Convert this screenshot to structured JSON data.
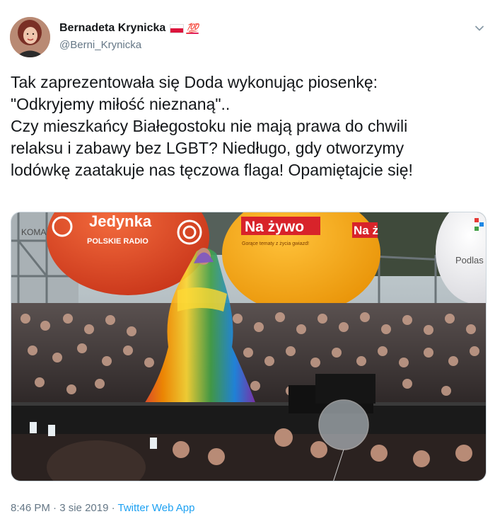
{
  "author": {
    "display_name": "Bernadeta Krynicka",
    "handle": "@Berni_Krynicka",
    "badge": "💯"
  },
  "tweet": {
    "lines": [
      "Tak zaprezentowała się Doda wykonując piosenkę:",
      "\"Odkryjemy miłość nieznaną\"..",
      "Czy mieszkańcy Białegostoku nie mają prawa do chwili",
      "relaksu i zabawy bez LGBT? Niedługo, gdy otworzymy",
      "lodówkę zaatakuje nas tęczowa flaga! Opamiętajcie się!"
    ]
  },
  "photo": {
    "balloon_left_title": "Jedynka",
    "balloon_left_subtitle": "POLSKIE RADIO",
    "balloon_center_title": "Na żywo",
    "balloon_center_subtitle": "Gorące tematy z życia gwiazd!",
    "balloon_center_partial": "Na ż",
    "balloon_right_text": "Podlas",
    "scaffold_text": "KOMA"
  },
  "meta": {
    "time": "8:46 PM",
    "separator": " · ",
    "date": "3 sie 2019",
    "source": "Twitter Web App"
  },
  "colors": {
    "text": "#14171a",
    "secondary": "#657786",
    "link": "#1da1f2",
    "badge": "#e0245e"
  }
}
